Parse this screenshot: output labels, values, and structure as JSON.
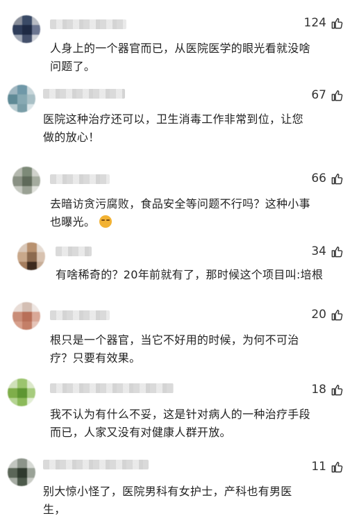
{
  "comments": [
    {
      "likes": "124",
      "text": "人身上的一个器官而已，从医院医学的眼光看就没啥\n问题了。"
    },
    {
      "likes": "67",
      "text": "医院这种治疗还可以，卫生消毒工作非常到位，让您\n做的放心！"
    },
    {
      "likes": "66",
      "text": "去暗访贪污腐败，食品安全等问题不行吗？这种小事\n也曝光。",
      "emoji": "grimace-emoji"
    },
    {
      "likes": "34",
      "text": "有啥稀奇的？20年前就有了，那时候这个项目叫:培根"
    },
    {
      "likes": "20",
      "text": "根只是一个器官，当它不好用的时候，为何不可治\n疗？只要有效果。"
    },
    {
      "likes": "18",
      "text": "我不认为有什么不妥，这是针对病人的一种治疗手段\n而已，人家又没有对健康人群开放。"
    },
    {
      "likes": "11",
      "text": "别大惊小怪了，医院男科有女护士，产科也有男医\n生，"
    }
  ],
  "colors": {
    "text": "#222222",
    "likes": "#333333",
    "background": "#ffffff"
  },
  "icons": {
    "like": "thumbs-up-icon",
    "avatar": "blurred-avatar",
    "username": "blurred-username"
  }
}
